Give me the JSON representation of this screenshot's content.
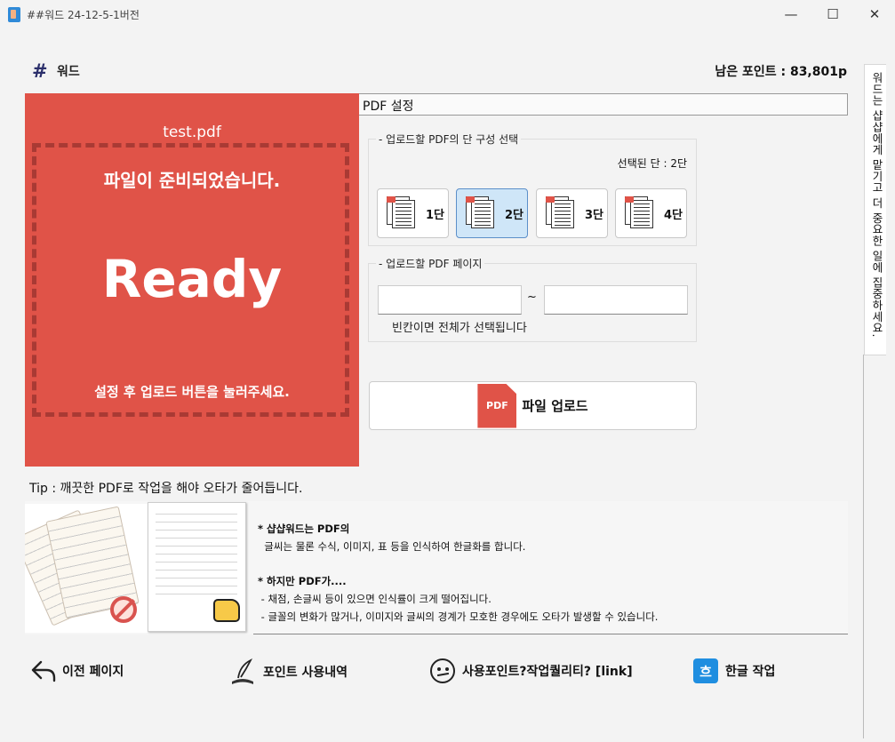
{
  "window": {
    "title": "##워드 24-12-5-1버전",
    "minimize_glyph": "—",
    "maximize_glyph": "☐",
    "close_glyph": "✕"
  },
  "header": {
    "brand_icon": "#",
    "brand_name": "워드",
    "points": "남은 포인트 : 83,801p"
  },
  "dropzone": {
    "filename": "test.pdf",
    "status": "파일이 준비되었습니다.",
    "big_text": "Ready",
    "hint": "설정 후 업로드 버튼을 눌러주세요.",
    "bg_color": "#e05348"
  },
  "settings": {
    "header": "PDF 설정",
    "columns": {
      "legend": "업로드할 PDF의 단 구성 선택",
      "selected_text": "선택된 단 : 2단",
      "options": [
        {
          "label": "1단",
          "selected": false
        },
        {
          "label": "2단",
          "selected": true
        },
        {
          "label": "3단",
          "selected": false
        },
        {
          "label": "4단",
          "selected": false
        }
      ]
    },
    "pages": {
      "legend": "업로드할 PDF 페이지",
      "from_value": "",
      "to_value": "",
      "separator": "~",
      "hint": "빈칸이면 전체가 선택됩니다"
    },
    "upload": {
      "icon_text": "PDF",
      "label": "파일 업로드"
    }
  },
  "tip": {
    "title": "Tip : 깨끗한 PDF로 작업을 해야 오타가 줄어듭니다.",
    "lines": [
      "* 샵샵워드는 PDF의",
      "  글씨는 물론 수식, 이미지, 표 등을 인식하여 한글화를 합니다.",
      "",
      "* 하지만 PDF가....",
      " - 채점, 손글씨 등이 있으면 인식률이 크게 떨어집니다.",
      " - 글꼴의 변화가 많거나, 이미지와 글씨의 경계가 모호한 경우에도 오타가 발생할 수 있습니다."
    ]
  },
  "footer": {
    "back": "이전 페이지",
    "points_history": "포인트 사용내역",
    "help": "사용포인트?작업퀄리티? [link]",
    "hangul_icon": "흐",
    "hangul": "한글 작업"
  },
  "side_tab": {
    "text": "워드는 샵샵에게 맡기고 더 중요한 일에 집중하세요."
  }
}
